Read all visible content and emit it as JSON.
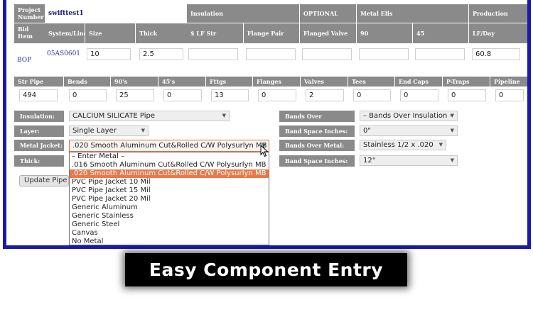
{
  "header": {
    "project_number_label": "Project Number",
    "project_number_value": "swifttest1",
    "insulation": "Insulation",
    "optional": "OPTIONAL",
    "metal_ells": "Metal Ells",
    "production": "Production"
  },
  "columns": {
    "bid_item": "Bid Item",
    "system_line": "System/Line",
    "size": "Size",
    "thick": "Thick",
    "lf_str": "$ LF Str",
    "flange_pair": "Flange Pair",
    "flanged_valve": "Flanged Valve",
    "c90": "90",
    "c45": "45",
    "lf_day": "LF/Day"
  },
  "row": {
    "bid_item": "BOP",
    "system_line": "05AS0601",
    "size": "10",
    "thick": "2.5",
    "lf_str": "",
    "flange_pair": "",
    "flanged_valve": "",
    "c90": "",
    "c45": "",
    "lf_day": "60.8"
  },
  "counts": {
    "headers": [
      "Str Pipe",
      "Bends",
      "90's",
      "45's",
      "Fttgs",
      "Flanges",
      "Valves",
      "Tees",
      "End Caps",
      "P-Traps",
      "Pipeline"
    ],
    "values": [
      "494",
      "0",
      "25",
      "0",
      "13",
      "0",
      "2",
      "0",
      "0",
      "0",
      "0"
    ]
  },
  "form_left": {
    "insulation_label": "Insulation:",
    "insulation_value": "CALCIUM SILICATE Pipe",
    "layer_label": "Layer:",
    "layer_value": "Single Layer",
    "metal_jacket_label": "Metal Jacket:",
    "metal_jacket_value": ".020 Smooth Aluminum Cut&Rolled C/W Polysurlyn MB",
    "thick_label": "Thick:"
  },
  "form_right": {
    "bands_over_insulation_label": "Bands Over Insulation:",
    "bands_over_insulation_value": "– Bands Over Insulation –",
    "band_space_inches_label": "Band Space Inches:",
    "band_space_inches_value": "0\"",
    "bands_over_metal_label": "Bands Over Metal:",
    "bands_over_metal_value": "Stainless 1/2 x .020",
    "band_space_inches2_label": "Band Space Inches:",
    "band_space_inches2_value": "12\""
  },
  "update_button": "Update Pipe",
  "metal_options": [
    "– Enter Metal –",
    ".016 Smooth Aluminum Cut&Rolled C/W Polysurlyn MB",
    ".020 Smooth Aluminum Cut&Rolled C/W Polysurlyn MB",
    "PVC Pipe Jacket 10 Mil",
    "PVC Pipe Jacket 15 Mil",
    "PVC Pipe Jacket 20 Mil",
    "Generic Aluminum",
    "Generic Stainless",
    "Generic Steel",
    "Canvas",
    "No Metal"
  ],
  "metal_selected_index": 2,
  "caption": "Easy Component Entry",
  "colors": {
    "frame": "#1a1aa8",
    "header_bg": "#8a8a8a",
    "highlight": "#e8794a",
    "caption_bg": "#000000"
  }
}
